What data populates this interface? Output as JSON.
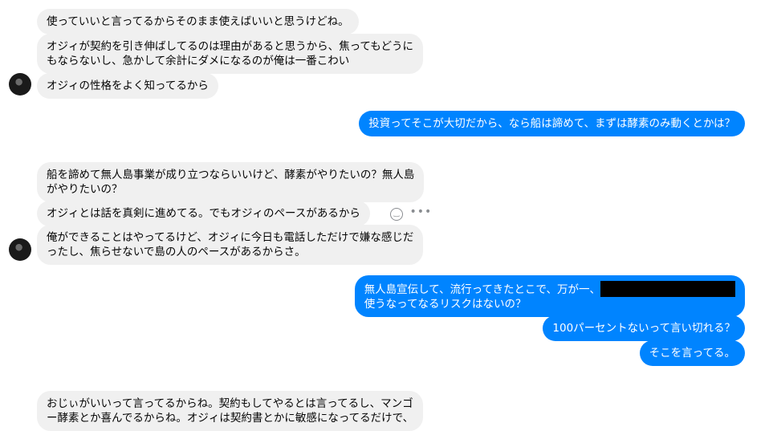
{
  "messages": [
    {
      "text": "使っていいと言ってるからそのまま使えばいいと思うけどね。"
    },
    {
      "line1": "オジィが契約を引き伸ばしてるのは理由があると思うから、焦ってもどうに",
      "line2": "もならないし、急かして余計にダメになるのが俺は一番こわい"
    },
    {
      "text": "オジィの性格をよく知ってるから"
    },
    {
      "text": "投資ってそこが大切だから、なら船は諦めて、まずは酵素のみ動くとかは？"
    },
    {
      "line1": "船を諦めて無人島事業が成り立つならいいけど、酵素がやりたいの？無人島",
      "line2": "がやりたいの？"
    },
    {
      "text": "オジィとは話を真剣に進めてる。でもオジィのペースがあるから"
    },
    {
      "line1": "俺ができることはやってるけど、オジィに今日も電話しただけで嫌な感じだ",
      "line2": "ったし、焦らせないで島の人のペースがあるからさ。"
    },
    {
      "line1": "無人島宣伝して、流行ってきたとこで、万が一、",
      "line2": "使うなってなるリスクはないの？"
    },
    {
      "text": "100パーセントないって言い切れる？"
    },
    {
      "text": "そこを言ってる。"
    },
    {
      "line1": "おじぃがいいって言ってるからね。契約もしてやるとは言ってるし、マンゴ",
      "line2": "ー酵素とか喜んでるからね。オジィは契約書とかに敏感になってるだけで、"
    }
  ],
  "colors": {
    "outgoing": "#0084ff",
    "incoming": "#f0f0f0"
  },
  "icons": {
    "react": "smiley-icon",
    "more": "ellipsis-icon"
  }
}
